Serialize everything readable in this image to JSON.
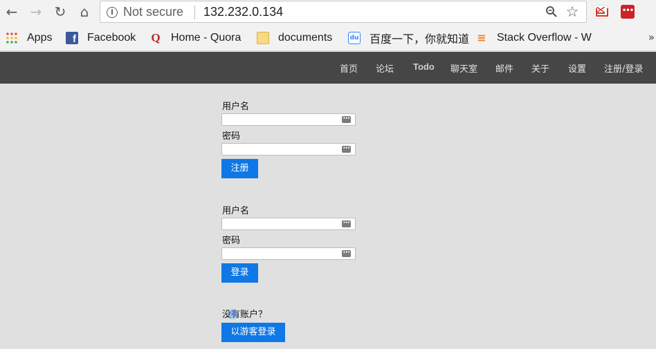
{
  "browser": {
    "security_label": "Not secure",
    "url": "132.232.0.134",
    "info_icon": "info-icon",
    "nav_icons": [
      "back-arrow-icon",
      "forward-arrow-icon",
      "reload-icon",
      "home-icon"
    ],
    "omnibox_icons": [
      "zoom-icon",
      "star-icon"
    ],
    "extensions": [
      "gmail-icon",
      "lastpass-icon"
    ],
    "lastpass_glyph": "•••"
  },
  "bookmarks": {
    "items": [
      {
        "label": "Apps",
        "icon": "apps-grid-icon"
      },
      {
        "label": "Facebook",
        "icon": "facebook-icon",
        "glyph": "f"
      },
      {
        "label": "Home - Quora",
        "icon": "quora-icon",
        "glyph": "Q"
      },
      {
        "label": "documents",
        "icon": "folder-icon"
      },
      {
        "label": "百度一下，你就知道",
        "icon": "baidu-icon",
        "glyph": "du"
      },
      {
        "label": "Stack Overflow - W",
        "icon": "stackoverflow-icon",
        "glyph": "≡"
      }
    ],
    "more": "»"
  },
  "navbar": {
    "items": [
      {
        "label": "首页"
      },
      {
        "label": "论坛"
      },
      {
        "label": "Todo",
        "active": true
      },
      {
        "label": "聊天室"
      },
      {
        "label": "邮件"
      },
      {
        "label": "关于"
      },
      {
        "label": "设置"
      },
      {
        "label": "注册/登录"
      }
    ]
  },
  "register_form": {
    "username_label": "用户名",
    "username_value": "",
    "password_label": "密码",
    "password_value": "",
    "submit_label": "注册"
  },
  "login_form": {
    "username_label": "用户名",
    "username_value": "",
    "password_label": "密码",
    "password_value": "",
    "submit_label": "登录"
  },
  "guest": {
    "prompt": "没有账户？",
    "button_label": "以游客登录"
  },
  "field_icon": "password-key-icon",
  "field_icon_glyph": "•••",
  "colors": {
    "navbar_bg": "#464646",
    "page_bg": "#e0e0e0",
    "button_primary": "#0f77e6"
  }
}
